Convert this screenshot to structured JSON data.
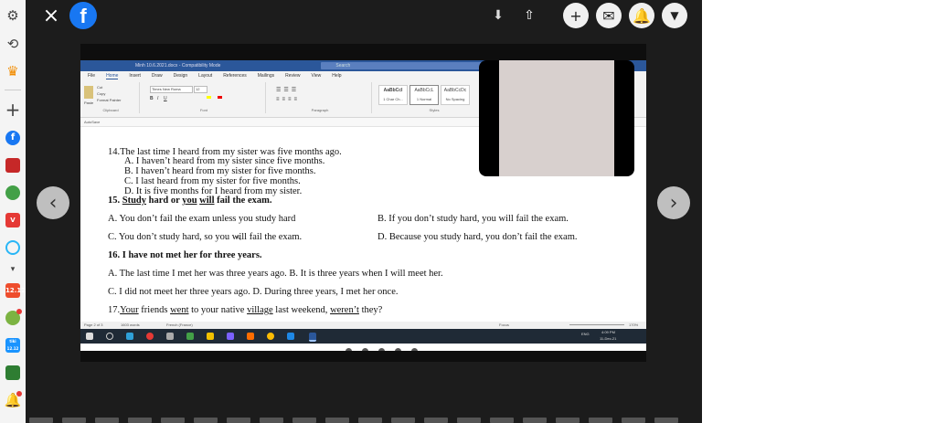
{
  "colors": {
    "rail_bg": "#f4f4f4",
    "viewer_bg": "#1c1c1c",
    "word_blue": "#2b579a",
    "taskbar": "#1f2a36"
  },
  "rail": {
    "badge_1": "12.12",
    "badge_2": "tiki 12.12"
  },
  "viewer": {
    "close_icon": "×",
    "logo_letter": "f",
    "actions": {
      "add": "+"
    },
    "prev_arrow": "‹",
    "next_arrow": "›"
  },
  "word": {
    "titlebar": {
      "filename": "Minh 10.6.2021.docx - Compatibility Mode",
      "search": "Search"
    },
    "menu": [
      "File",
      "Home",
      "Insert",
      "Draw",
      "Design",
      "Layout",
      "References",
      "Mailings",
      "Review",
      "View",
      "Help"
    ],
    "ribbon": {
      "clipboard": "Clipboard",
      "paste": "Paste",
      "cut": "Cut",
      "copy": "Copy",
      "format_painter": "Format Painter",
      "font_name": "Times New Roma",
      "font_size": "12",
      "font_label": "Font",
      "paragraph_label": "Paragraph",
      "styles_label": "Styles",
      "styles": [
        {
          "preview": "AaBbCcI",
          "name": "1 Char Ch..."
        },
        {
          "preview": "AaBbCcL",
          "name": "1 Normal"
        },
        {
          "preview": "AaBbCcDc",
          "name": "No Spacing"
        }
      ]
    },
    "quick_access": "AutoSave",
    "status": {
      "page": "Page 2 of 3",
      "words": "1603 words",
      "language": "French (France)",
      "focus": "Focus",
      "zoom": "170%"
    },
    "clock": {
      "time": "4:09 PM",
      "date": "11-Dec-21",
      "lang": "ENG"
    }
  },
  "doc": {
    "q14": "14.The last time I heard from my sister was five months ago.",
    "q14a": "A.  I haven’t heard from my sister since five months.",
    "q14b": "B.  I haven’t heard from my sister for five months.",
    "q14c": "C.  I last heard from my sister for five months.",
    "q14d": "D.  It is five months for I heard from my sister.",
    "q15_num": "15.",
    "q15_study": "Study",
    "q15_hard_or": "hard or",
    "q15_you": "you",
    "q15_will": "will",
    "q15_rest": "fail the exam.",
    "q15a": "A. You don’t fail the exam unless you study hard",
    "q15b": "B. If you don’t study hard, you will fail the exam.",
    "q15c": "C. You don’t study hard, so you will fail the exam.",
    "q15d": "D. Because you study hard, you don’t fail the exam.",
    "q16": "16. I have not met her for three years.",
    "q16ab": "A. The last time I met her was three years ago.  B. It is three years when I will meet her.",
    "q16cd": "C. I did not meet her three years ago.    D. During three years, I met her once.",
    "q17_num": "17.",
    "q17_your": "Your",
    "q17_p1": "friends",
    "q17_went": "went",
    "q17_p2": "to your native",
    "q17_village": "village",
    "q17_p3": "last weekend,",
    "q17_werent": "weren’t",
    "q17_p4": "they?"
  }
}
